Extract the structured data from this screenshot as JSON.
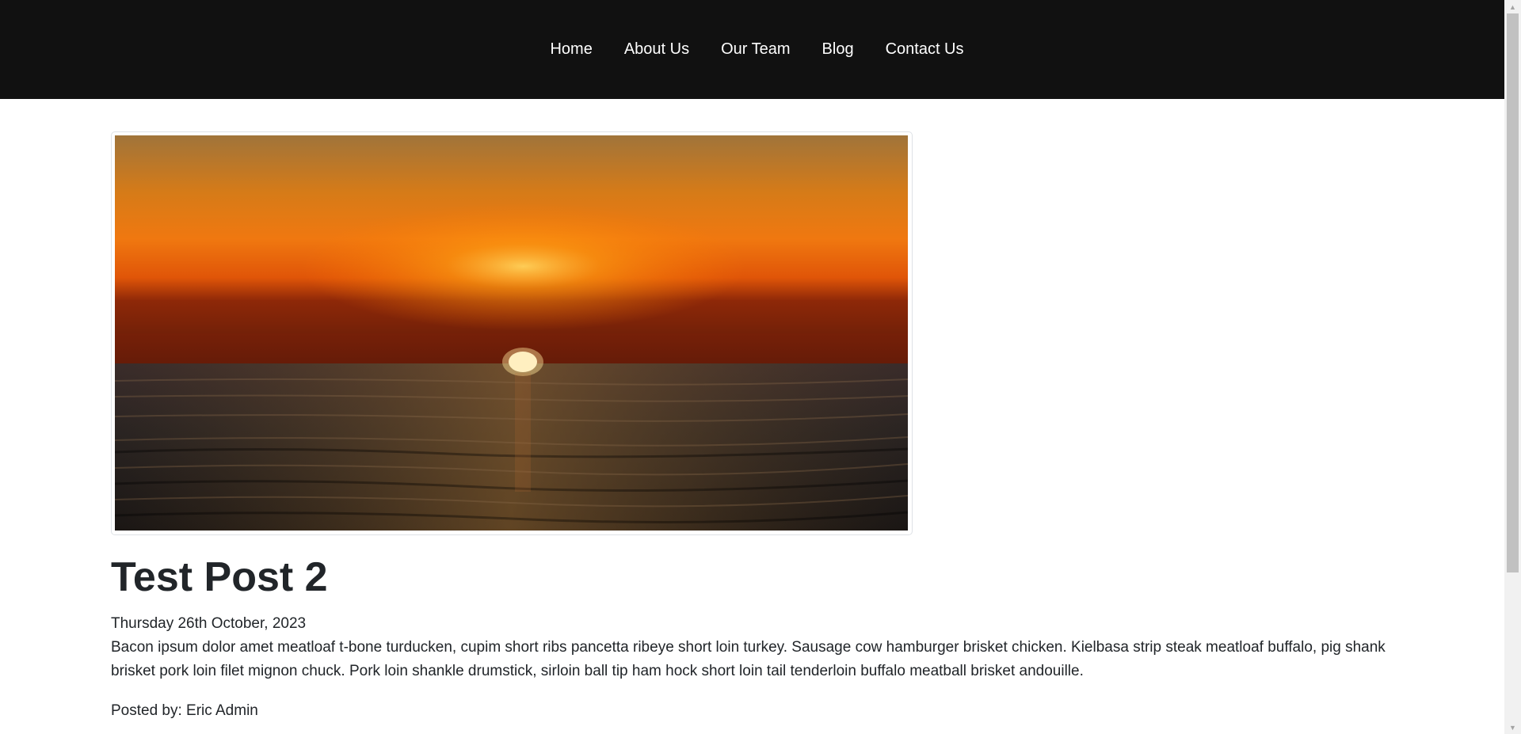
{
  "nav": {
    "items": [
      {
        "label": "Home"
      },
      {
        "label": "About Us"
      },
      {
        "label": "Our Team"
      },
      {
        "label": "Blog"
      },
      {
        "label": "Contact Us"
      }
    ]
  },
  "post": {
    "image": {
      "alt": "sunset-over-ocean",
      "icon": "sunset-photo"
    },
    "title": "Test Post 2",
    "date": "Thursday 26th October, 2023",
    "body": "Bacon ipsum dolor amet meatloaf t-bone turducken, cupim short ribs pancetta ribeye short loin turkey. Sausage cow hamburger brisket chicken. Kielbasa strip steak meatloaf buffalo, pig shank brisket pork loin filet mignon chuck. Pork loin shankle drumstick, sirloin ball tip ham hock short loin tail tenderloin buffalo meatball brisket andouille.",
    "author_line": "Posted by: Eric Admin"
  },
  "colors": {
    "navbar_bg": "#111111",
    "nav_text": "#ffffff",
    "body_text": "#212529"
  }
}
